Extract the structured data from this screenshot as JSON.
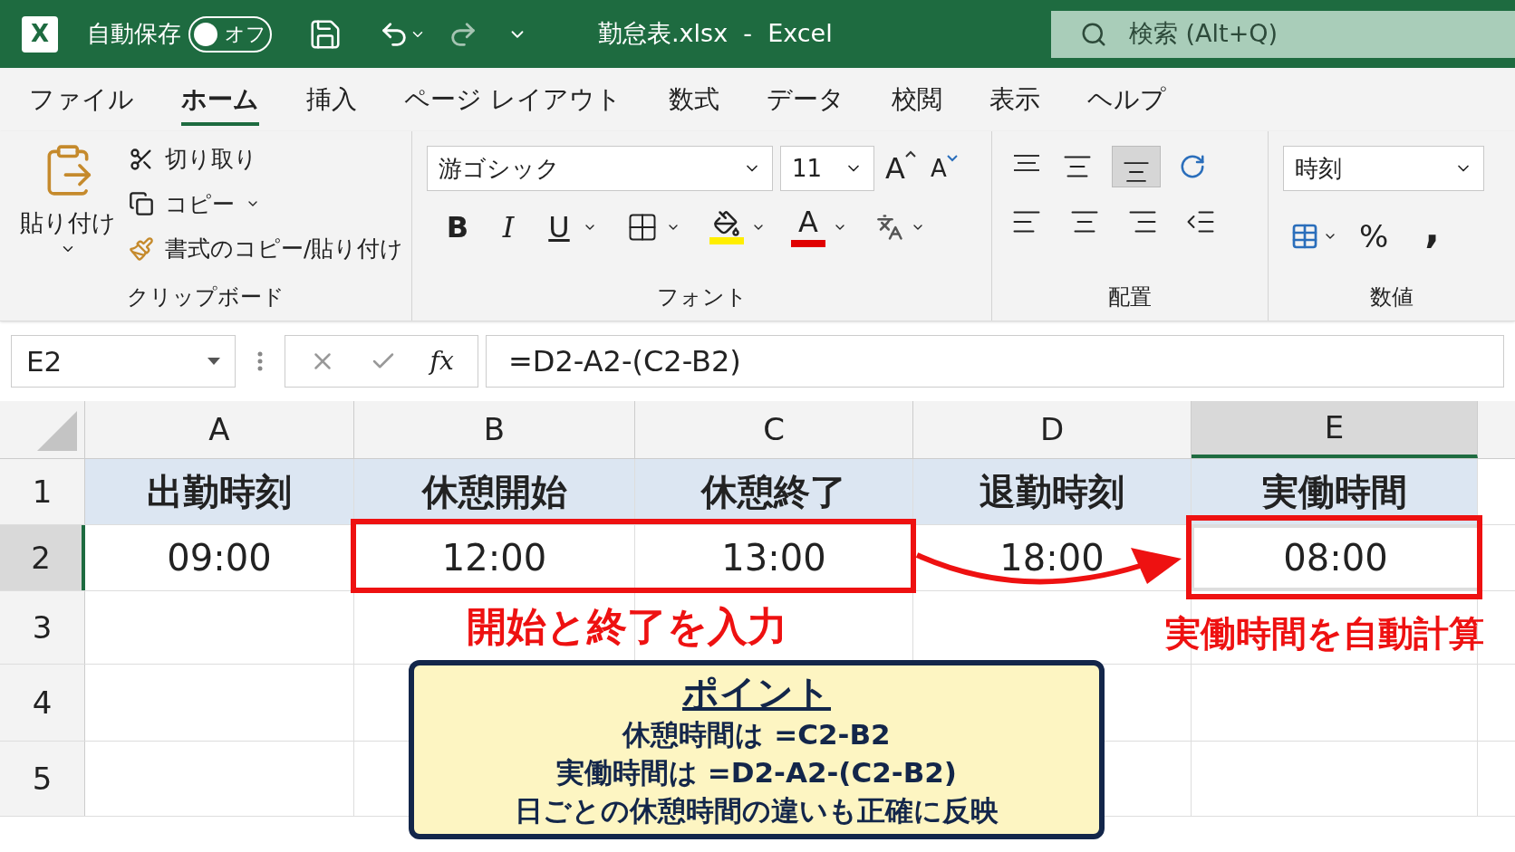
{
  "title_bar": {
    "logo_letter": "X",
    "autosave_label": "自動保存",
    "autosave": {
      "label": "オフ",
      "on": false
    },
    "file_title": "勤怠表.xlsx  -  Excel",
    "search": {
      "placeholder": "検索 (Alt+Q)"
    }
  },
  "tabs": [
    {
      "label": "ファイル",
      "selected": false
    },
    {
      "label": "ホーム",
      "selected": true
    },
    {
      "label": "挿入",
      "selected": false
    },
    {
      "label": "ページ レイアウト",
      "selected": false
    },
    {
      "label": "数式",
      "selected": false
    },
    {
      "label": "データ",
      "selected": false
    },
    {
      "label": "校閲",
      "selected": false
    },
    {
      "label": "表示",
      "selected": false
    },
    {
      "label": "ヘルプ",
      "selected": false
    }
  ],
  "ribbon": {
    "clipboard": {
      "label": "クリップボード",
      "paste": "貼り付け",
      "cut": "切り取り",
      "copy": "コピー",
      "format_painter": "書式のコピー/貼り付け"
    },
    "font": {
      "label": "フォント",
      "font_name": "游ゴシック",
      "font_size": "11",
      "grow": "A",
      "shrink": "A",
      "bold": "B",
      "italic": "I",
      "underline": "U",
      "font_color": "A"
    },
    "alignment": {
      "label": "配置",
      "bottom_align_selected": true
    },
    "number": {
      "label": "数値",
      "format": "時刻",
      "percent": "%",
      "comma": ","
    }
  },
  "formula_bar": {
    "name_box": "E2",
    "fx": "fx",
    "formula": "=D2-A2-(C2-B2)"
  },
  "sheet": {
    "columns": [
      {
        "label": "A",
        "selected": false
      },
      {
        "label": "B",
        "selected": false
      },
      {
        "label": "C",
        "selected": false
      },
      {
        "label": "D",
        "selected": false
      },
      {
        "label": "E",
        "selected": true
      }
    ],
    "rows": [
      {
        "label": "1",
        "selected": false,
        "kind": "header",
        "cells": [
          "出勤時刻",
          "休憩開始",
          "休憩終了",
          "退勤時刻",
          "実働時間"
        ]
      },
      {
        "label": "2",
        "selected": true,
        "kind": "data",
        "cells": [
          "09:00",
          "12:00",
          "13:00",
          "18:00",
          "08:00"
        ]
      },
      {
        "label": "3",
        "selected": false,
        "kind": "data",
        "cells": []
      },
      {
        "label": "4",
        "selected": false,
        "kind": "data",
        "cells": []
      },
      {
        "label": "5",
        "selected": false,
        "kind": "data",
        "cells": []
      }
    ]
  },
  "annotations": {
    "input_label": "開始と終了を入力",
    "result_label": "実働時間を自動計算",
    "point": {
      "title": "ポイント",
      "lines": [
        "休憩時間は =C2-B2",
        "実働時間は =D2-A2-(C2-B2)",
        "日ごとの休憩時間の違いも正確に反映"
      ]
    }
  }
}
